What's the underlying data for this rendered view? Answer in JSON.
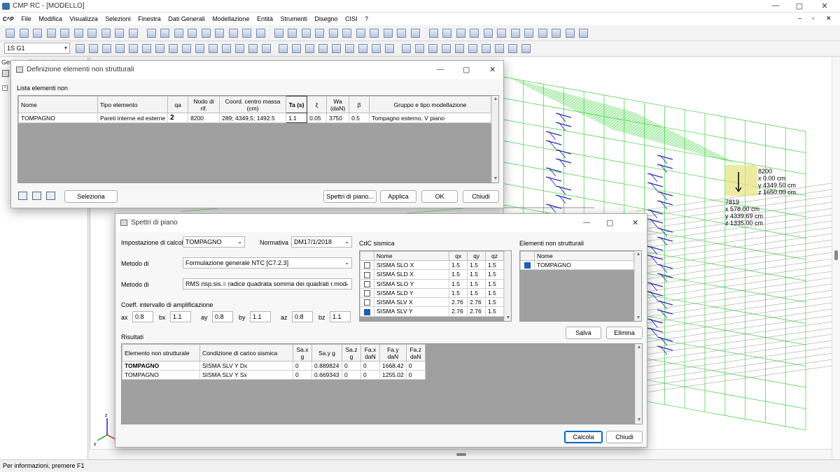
{
  "app": {
    "title": "CMP RC - [MODELLO]",
    "logo": "C^P"
  },
  "menu": [
    "File",
    "Modifica",
    "Visualizza",
    "Selezioni",
    "Finestra",
    "Dati Generali",
    "Modellazione",
    "Entità",
    "Strumenti",
    "Disegno",
    "CISI",
    "?"
  ],
  "toolbar": {
    "combo_value": "1S G1"
  },
  "left_panel": {
    "title": "Gestione Selezioni"
  },
  "viewport": {
    "labels": {
      "node1": "8200",
      "node1_x": "x 0.00 cm",
      "node1_y": "y 4349.50 cm",
      "node1_z": "z 1650.00 cm",
      "node2": "7819",
      "node2_x": "x 578.00 cm",
      "node2_y": "y 4339.69 cm",
      "node2_z": "z 1335.00 cm"
    },
    "axes": {
      "x": "x",
      "y": "y",
      "z": "z"
    },
    "colors": {
      "mesh": "#3cd13c",
      "detail": "#2b2bb0"
    }
  },
  "dlg1": {
    "title": "Definizione elementi non strutturali",
    "list_label": "Lista elementi non",
    "headers": [
      "Nome",
      "Tipo elemento",
      "qa",
      "Nodo di rif.",
      "Coord. centro massa (cm)",
      "Ta (s)",
      "ξ",
      "Wa (daN)",
      "β",
      "Gruppo e tipo modellazione"
    ],
    "row": [
      "TOMPAGNO",
      "Pareti interne ed esterne",
      "2",
      "8200",
      "289; 4349,5; 1492.5",
      "1.1",
      "0.05",
      "3750",
      "0.5",
      "Tompagno esterno, V piano"
    ],
    "buttons": {
      "seleziona": "Seleziona",
      "spettri": "Spettri di piano...",
      "applica": "Applica",
      "ok": "OK",
      "chiudi": "Chiudi"
    }
  },
  "dlg2": {
    "title": "Spettri di piano",
    "imp_label": "Impostazione di calcolo",
    "imp_value": "TOMPAGNO",
    "norm_label": "Normativa",
    "norm_value": "DM17/1/2018",
    "metodo1_label": "Metodo di",
    "metodo1_value": "Formulazione generale NTC [C7.2.3]",
    "metodo2_label": "Metodo di",
    "metodo2_value": "RMS risp.sis.= radice quadrata somma dei quadrati r.mod",
    "coeff_label": "Coeff. intervallo di amplificazione",
    "coeffs": [
      {
        "l": "ax",
        "v": "0.8"
      },
      {
        "l": "bx",
        "v": "1.1"
      },
      {
        "l": "ay",
        "v": "0.8"
      },
      {
        "l": "by",
        "v": "1.1"
      },
      {
        "l": "az",
        "v": "0.8"
      },
      {
        "l": "bz",
        "v": "1.1"
      }
    ],
    "cdc_label": "CdC sismica",
    "cdc_headers": [
      "Nome",
      "qx",
      "qy",
      "qz"
    ],
    "cdc_rows": [
      {
        "name": "SISMA SLO X",
        "qx": "1.5",
        "qy": "1.5",
        "qz": "1.5",
        "checked": false
      },
      {
        "name": "SISMA SLD X",
        "qx": "1.5",
        "qy": "1.5",
        "qz": "1.5",
        "checked": false
      },
      {
        "name": "SISMA SLO Y",
        "qx": "1.5",
        "qy": "1.5",
        "qz": "1.5",
        "checked": false
      },
      {
        "name": "SISMA SLD Y",
        "qx": "1.5",
        "qy": "1.5",
        "qz": "1.5",
        "checked": false
      },
      {
        "name": "SISMA SLV X",
        "qx": "2.76",
        "qy": "2.76",
        "qz": "1.5",
        "checked": false
      },
      {
        "name": "SISMA SLV Y",
        "qx": "2.76",
        "qy": "2.76",
        "qz": "1.5",
        "checked": true
      }
    ],
    "ens_label": "Elementi non strutturali",
    "ens_header": "Nome",
    "ens_rows": [
      {
        "name": "TOMPAGNO",
        "checked": true
      }
    ],
    "risultati_label": "Risultati",
    "res_headers": [
      "Elemento non strutturale",
      "Condizione di carico sismica",
      "Sa.x g",
      "Sa.y g",
      "Sa.z g",
      "Fa.x daN",
      "Fa.y daN",
      "Fa.z daN"
    ],
    "res_rows": [
      [
        "TOMPAGNO",
        "SISMA SLV Y Dx",
        "0",
        "0.889824",
        "0",
        "0",
        "1668.42",
        "0"
      ],
      [
        "TOMPAGNO",
        "SISMA SLV Y Sx",
        "0",
        "0.669343",
        "0",
        "0",
        "1255.02",
        "0"
      ]
    ],
    "buttons": {
      "salva": "Salva",
      "elimina": "Elimina",
      "calcola": "Calcola",
      "chiudi": "Chiudi"
    }
  },
  "status": "Per informazioni, premere F1"
}
